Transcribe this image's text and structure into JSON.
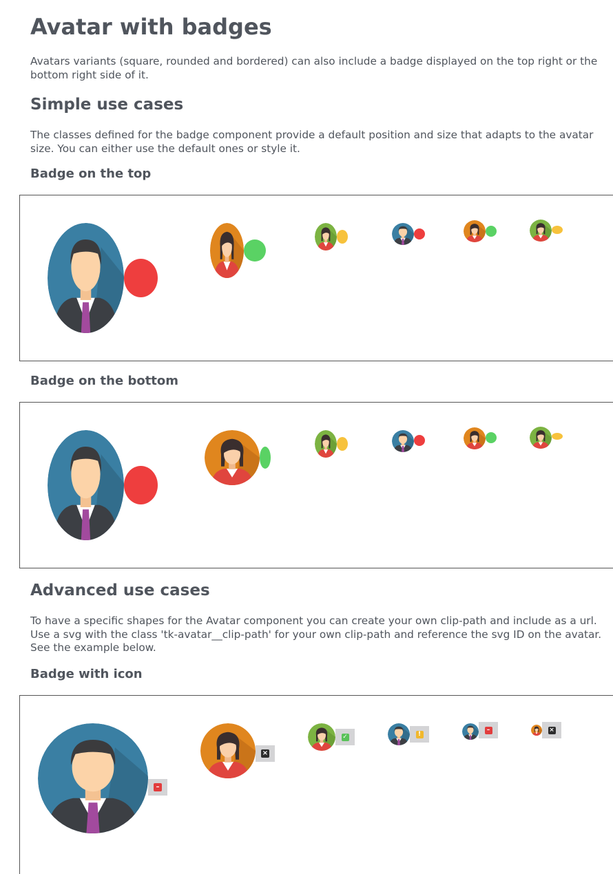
{
  "page": {
    "title": "Avatar with badges",
    "intro": "Avatars variants (square, rounded and bordered) can also include a badge displayed on the top right or the bottom right side of it.",
    "simple_title": "Simple use cases",
    "simple_desc": "The classes defined for the badge component provide a default position and size that adapts to the avatar size. You can either use the default ones or style it.",
    "badge_top_title": "Badge on the top",
    "badge_bottom_title": "Badge on the bottom",
    "advanced_title": "Advanced use cases",
    "advanced_desc": "To have a specific shapes for the Avatar component you can create your own clip-path and include as a url. Use a svg with the class 'tk-avatar__clip-path' for your own clip-path and reference the svg ID on the avatar. See the example below.",
    "badge_icon_title": "Badge with icon"
  },
  "colors": {
    "badge_red": "#ee3e3e",
    "badge_green": "#5ad264",
    "badge_yellow": "#f7c23c",
    "bg_blue": "#3a7fa3",
    "bg_orange": "#e0861e",
    "bg_green": "#7cb342",
    "icon_badge_bg": "#d4d4d6"
  },
  "avatar_people": {
    "man": "man-avatar",
    "woman": "woman-avatar"
  },
  "icon_badges": [
    {
      "status": "busy",
      "icon": "minus-icon",
      "color": "#e23d3d"
    },
    {
      "status": "offline",
      "icon": "close-icon",
      "color": "#2d2d2d"
    },
    {
      "status": "online",
      "icon": "check-icon",
      "color": "#5ac25a"
    },
    {
      "status": "away",
      "icon": "exclamation-icon",
      "color": "#f1b82d"
    },
    {
      "status": "busy",
      "icon": "minus-icon",
      "color": "#e23d3d"
    },
    {
      "status": "offline",
      "icon": "close-icon",
      "color": "#2d2d2d"
    }
  ]
}
